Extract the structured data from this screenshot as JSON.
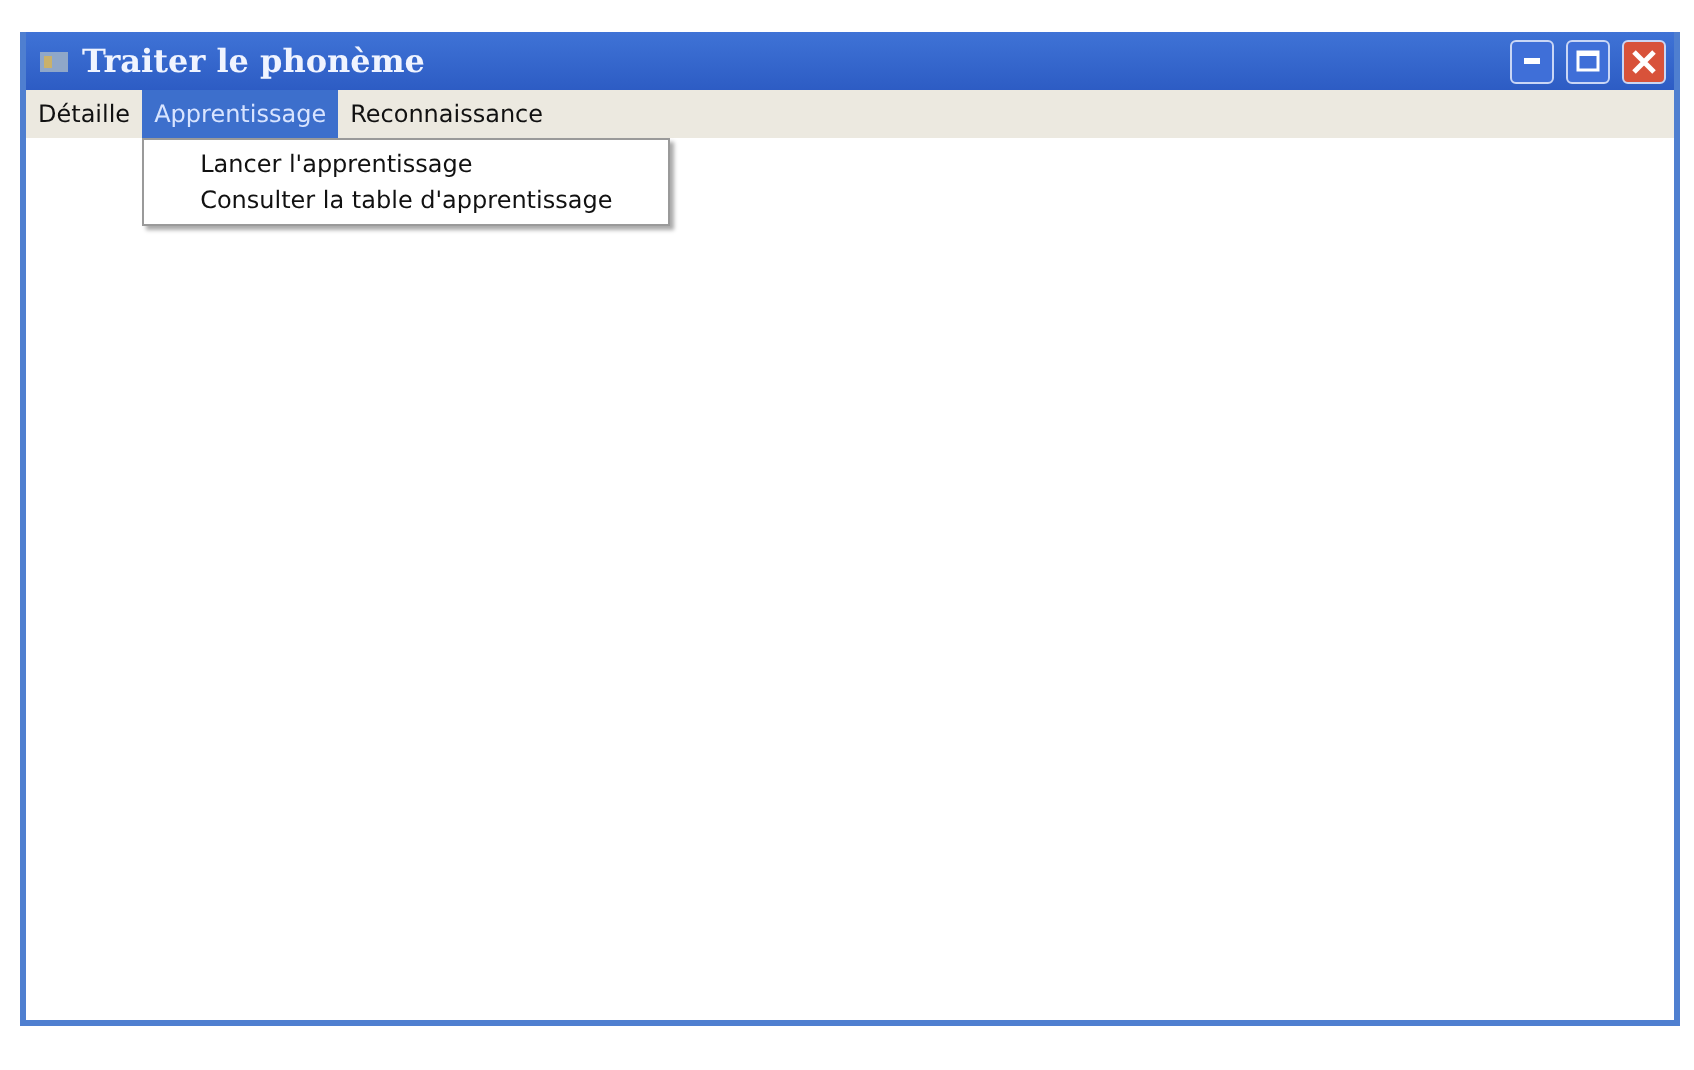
{
  "window": {
    "title": "Traiter le phonème"
  },
  "menu": [
    {
      "label": "Détaille",
      "selected": false
    },
    {
      "label": "Apprentissage",
      "selected": true,
      "items": [
        "Lancer l'apprentissage",
        "Consulter la table d'apprentissage"
      ]
    },
    {
      "label": "Reconnaissance",
      "selected": false
    }
  ]
}
